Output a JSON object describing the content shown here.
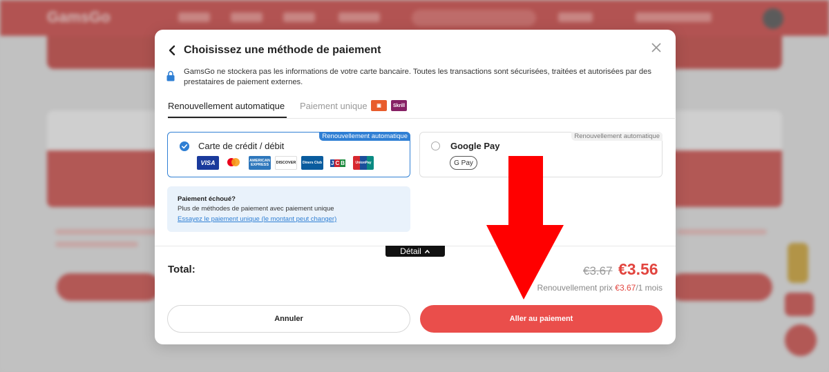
{
  "background": {
    "logo": "GamsGo"
  },
  "modal": {
    "title": "Choisissez une méthode de paiement",
    "notice": "GamsGo ne stockera pas les informations de votre carte bancaire. Toutes les transactions sont sécurisées, traitées et autorisées par des prestataires de paiement externes.",
    "tabs": [
      {
        "label": "Renouvellement automatique",
        "active": true
      },
      {
        "label": "Paiement unique",
        "active": false
      }
    ],
    "one_time_logos": [
      "paysafecard",
      "Skrill"
    ],
    "options": [
      {
        "title": "Carte de crédit / débit",
        "badge": "Renouvellement automatique",
        "selected": true,
        "brands": [
          "VISA",
          "Mastercard",
          "American Express",
          "DISCOVER",
          "Diners Club",
          "JCB",
          "UnionPay"
        ]
      },
      {
        "title": "Google Pay",
        "badge": "Renouvellement automatique",
        "selected": false,
        "button": "G Pay"
      }
    ],
    "failed": {
      "title": "Paiement échoué?",
      "subtitle": "Plus de méthodes de paiement avec paiement unique",
      "link": "Essayez le paiement unique (le montant peut changer)"
    },
    "detail_label": "Détail",
    "total": {
      "label": "Total:",
      "old_price": "€3.67",
      "new_price": "€3.56",
      "renewal_prefix": "Renouvellement prix ",
      "renewal_price": "€3.67",
      "renewal_suffix": "/1 mois"
    },
    "buttons": {
      "cancel": "Annuler",
      "pay": "Aller au paiement"
    }
  },
  "colors": {
    "accent_red": "#ea4e4b",
    "accent_blue": "#2f7fd4",
    "arrow_red": "#ff0000"
  }
}
